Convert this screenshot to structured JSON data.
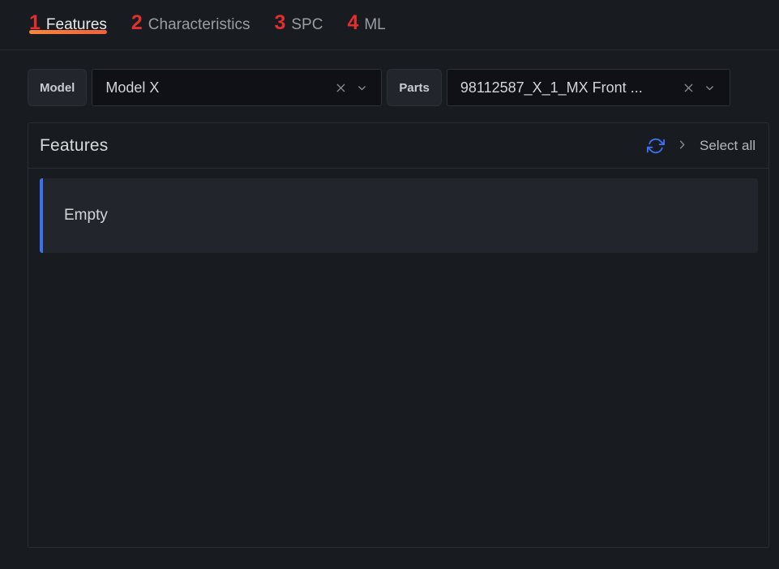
{
  "tabs": [
    {
      "number": "1",
      "label": "Features",
      "active": true
    },
    {
      "number": "2",
      "label": "Characteristics",
      "active": false
    },
    {
      "number": "3",
      "label": "SPC",
      "active": false
    },
    {
      "number": "4",
      "label": "ML",
      "active": false
    }
  ],
  "selectors": [
    {
      "tag": "Model",
      "value": "Model X",
      "placeholder": "Model X",
      "clear_icon": "close-icon",
      "dropdown_icon": "chevron-down-icon"
    },
    {
      "tag": "Parts",
      "value": "98112587_X_1_MX Front ...",
      "placeholder": "98112587_X_1_MX Front ...",
      "clear_icon": "close-icon",
      "dropdown_icon": "chevron-down-icon"
    }
  ],
  "panel": {
    "title": "Features",
    "refresh_icon": "refresh-icon",
    "expand_icon": "chevron-right-icon",
    "select_all_label": "Select all",
    "rows": [
      {
        "label": "Empty"
      }
    ]
  },
  "colors": {
    "page_bg": "#181b1f",
    "tab_number": "#e02f2f",
    "tab_active_text": "#e9eaec",
    "tab_inactive_text": "#9a9da3",
    "underline_from": "#f9873b",
    "underline_to": "#f0603c",
    "accent_blue": "#3d71f2",
    "row_bg": "#22262c",
    "input_bg": "#0f1116",
    "border": "#2a2e34"
  }
}
